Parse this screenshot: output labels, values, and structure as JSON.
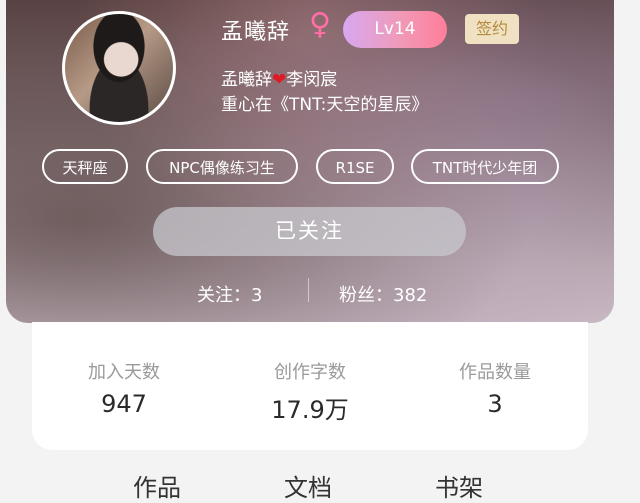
{
  "profile": {
    "name": "孟曦辞",
    "gender_symbol": "♀",
    "level": "Lv14",
    "sign_badge": "签约",
    "relation_left": "孟曦辞",
    "relation_heart": "❤",
    "relation_right": "李闵宸",
    "focus_text": "重心在《TNT:天空的星辰》"
  },
  "tags": [
    "天秤座",
    "NPC偶像练习生",
    "R1SE",
    "TNT时代少年团"
  ],
  "follow_button": "已关注",
  "counts": {
    "following_label": "关注：3",
    "fans_label": "粉丝：382"
  },
  "stats": [
    {
      "label": "加入天数",
      "value": "947"
    },
    {
      "label": "创作字数",
      "value": "17.9万"
    },
    {
      "label": "作品数量",
      "value": "3"
    }
  ],
  "bottom_tabs": [
    "作品",
    "文档",
    "书架"
  ],
  "colors": {
    "gender": "#ff6ea5",
    "level_gradient": [
      "#d7a8f0",
      "#ff7e9a"
    ],
    "sign_bg": "#efe1c2",
    "sign_text": "#b48a3d",
    "heart": "#e01a24"
  }
}
